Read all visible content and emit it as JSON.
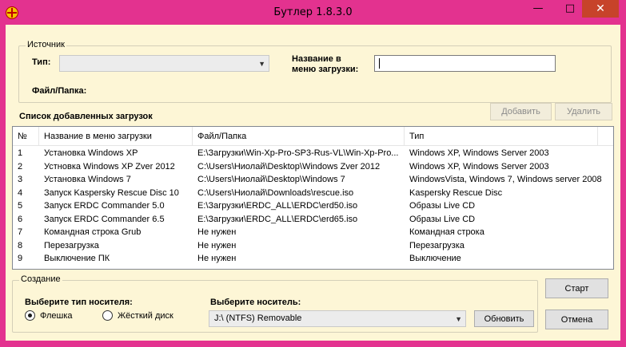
{
  "window": {
    "title": "Бутлер 1.8.3.0",
    "minimize_glyph": "—",
    "maximize_glyph": "□",
    "close_glyph": "✕"
  },
  "source_group": {
    "legend": "Источник",
    "type_label": "Тип:",
    "type_value": "",
    "menu_name_label_line1": "Название в",
    "menu_name_label_line2": "меню загрузки:",
    "menu_name_value": "",
    "path_label": "Файл/Папка:"
  },
  "list_section": {
    "title": "Список добавленных загрузок",
    "add_button": "Добавить",
    "delete_button": "Удалить"
  },
  "table": {
    "columns": [
      "№",
      "Название в меню загрузки",
      "Файл/Папка",
      "Тип"
    ],
    "rows": [
      [
        "1",
        "Установка  Windows XP",
        "E:\\Загрузки\\Win-Xp-Pro-SP3-Rus-VL\\Win-Xp-Pro...",
        "Windows XP, Windows Server 2003"
      ],
      [
        "2",
        "Устновка Windows XP Zver 2012",
        "C:\\Users\\Ниолай\\Desktop\\Windows Zver 2012",
        "Windows XP, Windows Server 2003"
      ],
      [
        "3",
        "Установка Windows 7",
        "C:\\Users\\Ниолай\\Desktop\\Windows 7",
        "WindowsVista, Windows 7, Windows server 2008"
      ],
      [
        "4",
        "Запуск Kaspersky Rescue Disc 10",
        "C:\\Users\\Ниолай\\Downloads\\rescue.iso",
        "Kaspersky Rescue Disc"
      ],
      [
        "5",
        "Запуск ERDC Commander 5.0",
        "E:\\Загрузки\\ERDC_ALL\\ERDC\\erd50.iso",
        "Образы Live CD"
      ],
      [
        "6",
        "Запуск ERDC Commander 6.5",
        "E:\\Загрузки\\ERDC_ALL\\ERDC\\erd65.iso",
        "Образы Live CD"
      ],
      [
        "7",
        "Командная строка Grub",
        "Не нужен",
        "Командная строка"
      ],
      [
        "8",
        "Перезагрузка",
        "Не нужен",
        "Перезагрузка"
      ],
      [
        "9",
        "Выключение ПК",
        "Не нужен",
        "Выключение"
      ]
    ]
  },
  "create_group": {
    "legend": "Создание",
    "media_type_label": "Выберите тип носителя:",
    "radio_flash": "Флешка",
    "radio_hdd": "Жёсткий диск",
    "selected_media_type": "flash",
    "device_label": "Выберите носитель:",
    "device_value": "J:\\  (NTFS)  Removable",
    "refresh_button": "Обновить"
  },
  "actions": {
    "start_button": "Старт",
    "cancel_button": "Отмена"
  },
  "colors": {
    "window_frame": "#e3328f",
    "client_background": "#fdf6d6",
    "close_button": "#c7432a"
  }
}
